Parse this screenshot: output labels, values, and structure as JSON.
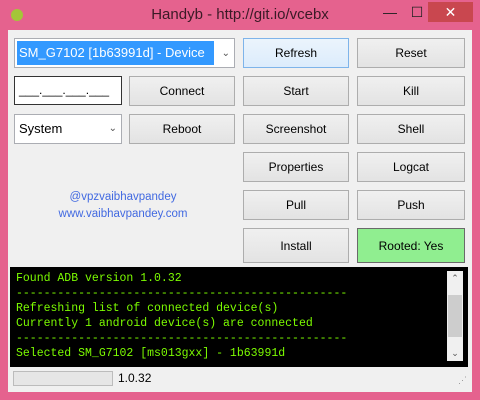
{
  "window": {
    "title": "Handyb - http://git.io/vcebx",
    "minimize": "—",
    "maximize": "☐",
    "close": "✕"
  },
  "device_select": {
    "value": "SM_G7102 [1b63991d] - Device"
  },
  "ip_input": {
    "value": "___.___.___.___"
  },
  "mode_select": {
    "value": "System"
  },
  "buttons": {
    "refresh": "Refresh",
    "reset": "Reset",
    "connect": "Connect",
    "start": "Start",
    "kill": "Kill",
    "reboot": "Reboot",
    "screenshot": "Screenshot",
    "shell": "Shell",
    "properties": "Properties",
    "logcat": "Logcat",
    "pull": "Pull",
    "push": "Push",
    "install": "Install",
    "rooted": "Rooted: Yes"
  },
  "credits": {
    "twitter": "@vpzvaibhavpandey",
    "website": "www.vaibhavpandey.com"
  },
  "console": {
    "lines": [
      "Found ADB version 1.0.32",
      "------------------------------------------------",
      "Refreshing list of connected device(s)",
      "Currently 1 android device(s) are connected",
      "------------------------------------------------",
      "Selected SM_G7102 [ms013gxx] - 1b63991d"
    ]
  },
  "status": {
    "version": "1.0.32",
    "progress": 0
  },
  "colors": {
    "frame": "#e5628e",
    "rooted": "#90ee90",
    "console_text": "#7cfc00",
    "link": "#4169e1"
  }
}
